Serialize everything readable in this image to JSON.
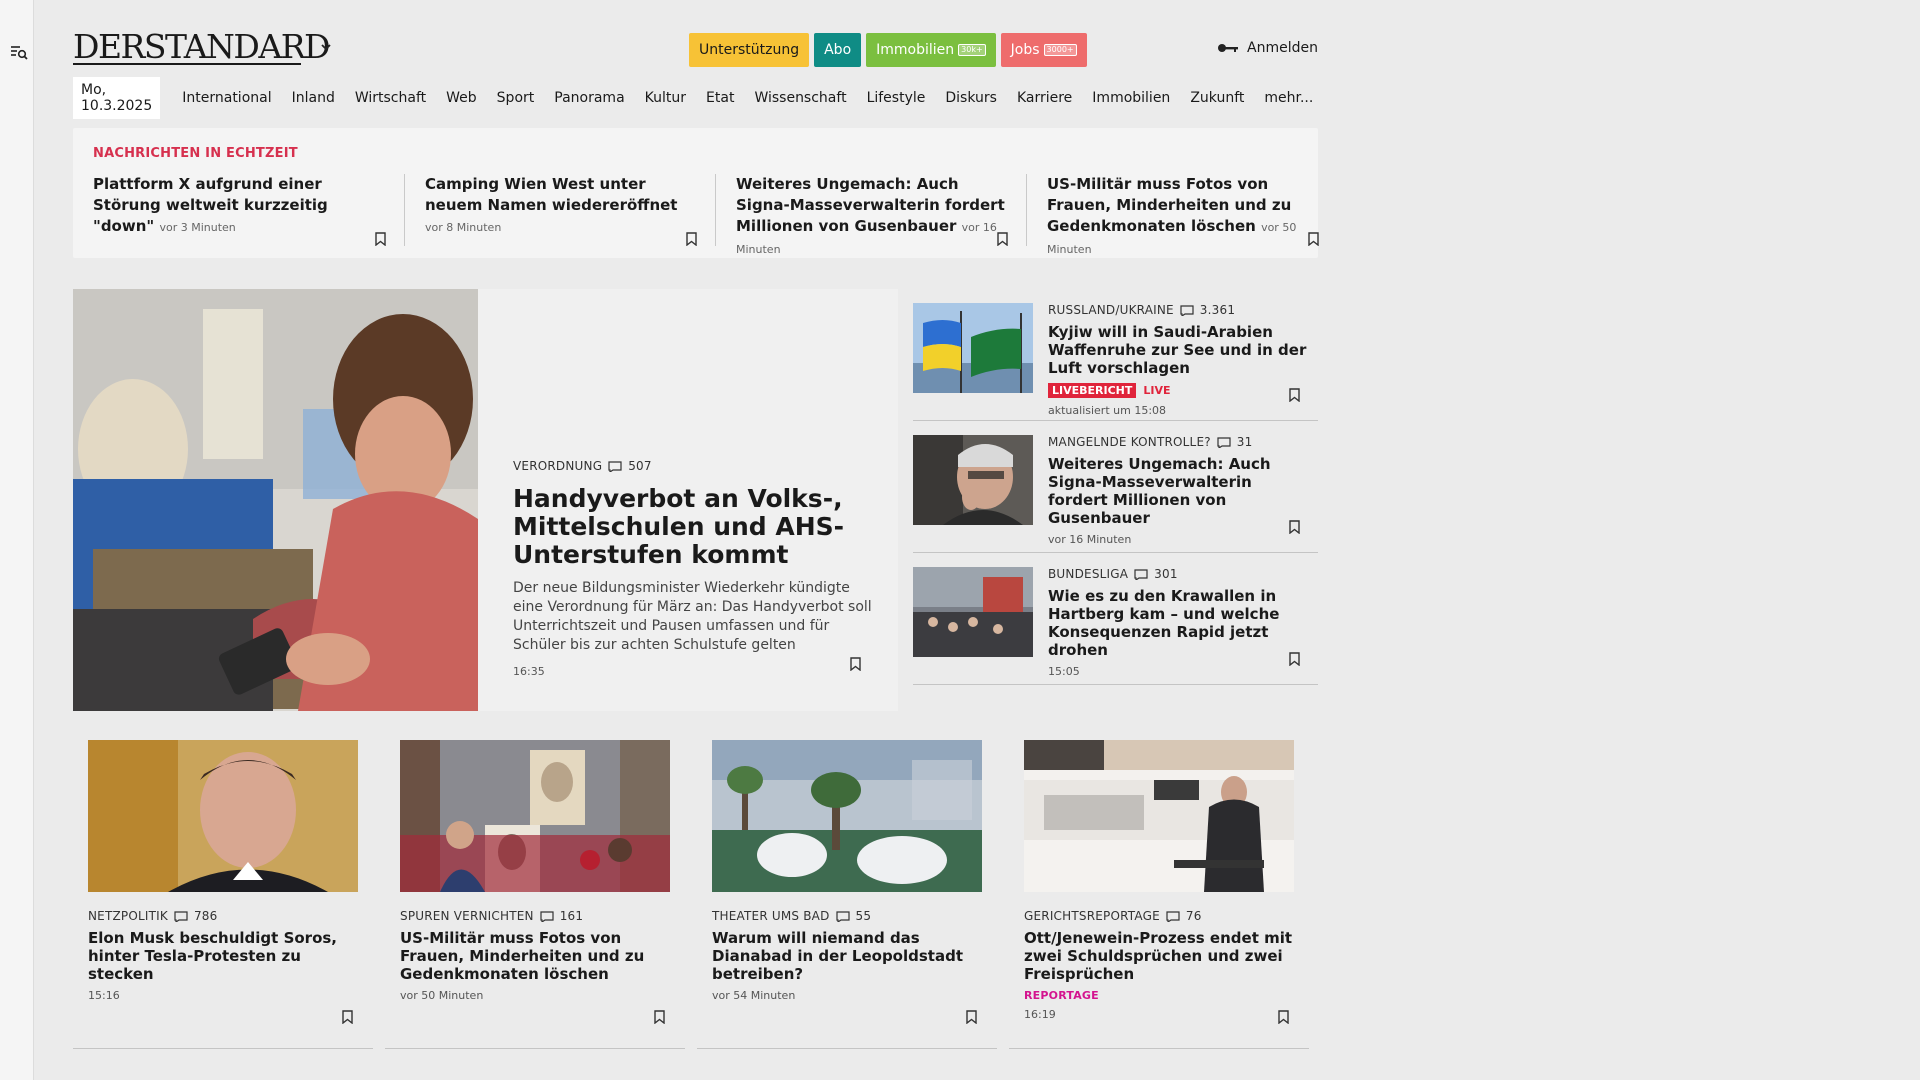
{
  "header": {
    "logo": "DERSTANDARD",
    "pills": {
      "support": "Unterstützung",
      "abo": "Abo",
      "immo": "Immobilien",
      "immo_badge": "30k+",
      "jobs": "Jobs",
      "jobs_badge": "3000+"
    },
    "login": "Anmelden"
  },
  "nav": {
    "date": "Mo, 10.3.2025",
    "items": [
      "International",
      "Inland",
      "Wirtschaft",
      "Web",
      "Sport",
      "Panorama",
      "Kultur",
      "Etat",
      "Wissenschaft",
      "Lifestyle",
      "Diskurs",
      "Karriere",
      "Immobilien",
      "Zukunft",
      "mehr..."
    ]
  },
  "ticker": {
    "title": "NACHRICHTEN IN ECHTZEIT",
    "items": [
      {
        "title": "Plattform X aufgrund einer Störung weltweit kurzzeitig \"down\"",
        "ago": "vor 3 Minuten"
      },
      {
        "title": "Camping Wien West unter neuem Namen wiedereröffnet",
        "ago": "vor 8 Minuten"
      },
      {
        "title": "Weiteres Ungemach: Auch Signa-Masseverwalterin fordert Millionen von Gusenbauer",
        "ago": "vor 16 Minuten"
      },
      {
        "title": "US-Militär muss Fotos von Frauen, Minderheiten und zu Gedenkmonaten löschen",
        "ago": "vor 50 Minuten"
      }
    ]
  },
  "hero": {
    "kicker": "VERORDNUNG",
    "comments": "507",
    "title": "Handyverbot an Volks-, Mittelschulen und AHS-Unterstufen kommt",
    "teaser": "Der neue Bildungsminister Wiederkehr kündigte eine Verordnung für März an: Das Handyverbot soll Unterrichtszeit und Pausen umfassen und für Schüler bis zur achten Schulstufe gelten",
    "time": "16:35"
  },
  "side": [
    {
      "kicker": "RUSSLAND/UKRAINE",
      "comments": "3.361",
      "title": "Kyjiw will in Saudi-Arabien Waffenruhe zur See und in der Luft vorschlagen",
      "live_badge": "LIVEBERICHT",
      "live": "LIVE",
      "meta": "aktualisiert um 15:08"
    },
    {
      "kicker": "MANGELNDE KONTROLLE?",
      "comments": "31",
      "title": "Weiteres Ungemach: Auch Signa-Masseverwalterin fordert Millionen von Gusenbauer",
      "meta": "vor 16 Minuten"
    },
    {
      "kicker": "BUNDESLIGA",
      "comments": "301",
      "title": "Wie es zu den Krawallen in Hartberg kam – und welche Konsequenzen Rapid jetzt drohen",
      "meta": "15:05"
    }
  ],
  "cards": [
    {
      "kicker": "NETZPOLITIK",
      "comments": "786",
      "title": "Elon Musk beschuldigt Soros, hinter Tesla-Protesten zu stecken",
      "meta": "15:16"
    },
    {
      "kicker": "SPUREN VERNICHTEN",
      "comments": "161",
      "title": "US-Militär muss Fotos von Frauen, Minderheiten und zu Gedenkmonaten löschen",
      "meta": "vor 50 Minuten"
    },
    {
      "kicker": "THEATER UMS BAD",
      "comments": "55",
      "title": "Warum will niemand das Dianabad in der Leopoldstadt betreiben?",
      "meta": "vor 54 Minuten"
    },
    {
      "kicker": "GERICHTSREPORTAGE",
      "comments": "76",
      "title": "Ott/Jenewein-Prozess endet mit zwei Schuldsprüchen und zwei Freisprüchen",
      "label": "REPORTAGE",
      "meta": "16:19"
    }
  ]
}
